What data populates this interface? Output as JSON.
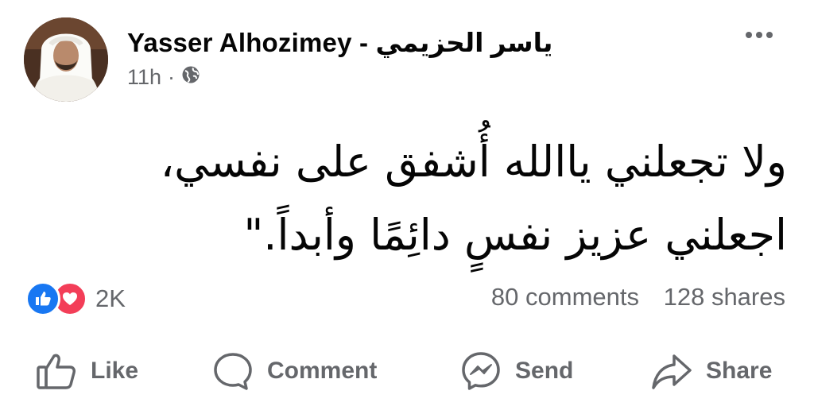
{
  "post": {
    "author": "Yasser Alhozimey - ياسر الحزيمي",
    "time": "11h",
    "separator": "·",
    "audience_icon": "globe-icon",
    "more_icon": "more-icon",
    "text_lines": [
      "ولا تجعلني ياالله أُشفق على نفسي،",
      "اجعلني عزيز نفسٍ دائِمًا وأبداً.\""
    ]
  },
  "stats": {
    "reaction_icons": [
      "like-icon",
      "love-icon"
    ],
    "reaction_count": "2K",
    "comments": "80 comments",
    "shares": "128 shares"
  },
  "actions": {
    "like": "Like",
    "comment": "Comment",
    "send": "Send",
    "share": "Share"
  },
  "colors": {
    "text": "#050505",
    "secondary": "#65676b",
    "like_blue": "#1877f2",
    "love_red": "#f33e58"
  }
}
